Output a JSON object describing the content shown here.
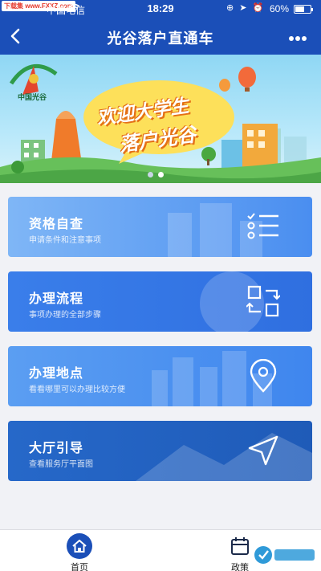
{
  "status_bar": {
    "watermark": "下载集 www.FXXZ.com",
    "carrier": "中国电信",
    "time": "18:29",
    "battery": "60%",
    "battery_level": 0.6
  },
  "nav": {
    "title": "光谷落户直通车"
  },
  "banner": {
    "logo_text": "中国光谷",
    "headline_1": "欢迎大学生",
    "headline_2": "落户光谷",
    "slide_count": 2,
    "active_slide": 1
  },
  "cards": [
    {
      "title": "资格自查",
      "subtitle": "申请条件和注意事项",
      "icon": "checklist-icon",
      "color_from": "#7fb6f6",
      "color_to": "#4a8ef0"
    },
    {
      "title": "办理流程",
      "subtitle": "事项办理的全部步骤",
      "icon": "flow-icon",
      "color_from": "#3a7eea",
      "color_to": "#2f6fe0"
    },
    {
      "title": "办理地点",
      "subtitle": "看看哪里可以办理比较方便",
      "icon": "location-pin-icon",
      "color_from": "#5b9ef2",
      "color_to": "#3f86ee"
    },
    {
      "title": "大厅引导",
      "subtitle": "查看服务厅平面图",
      "icon": "navigation-arrow-icon",
      "color_from": "#2668c9",
      "color_to": "#1f5bb8"
    }
  ],
  "tabbar": {
    "tabs": [
      {
        "label": "首页",
        "icon": "home-icon",
        "active": true
      },
      {
        "label": "政策",
        "icon": "calendar-icon",
        "active": false
      }
    ]
  },
  "colors": {
    "nav_bg": "#1b4fb8",
    "tab_active": "#1b4fb8"
  }
}
